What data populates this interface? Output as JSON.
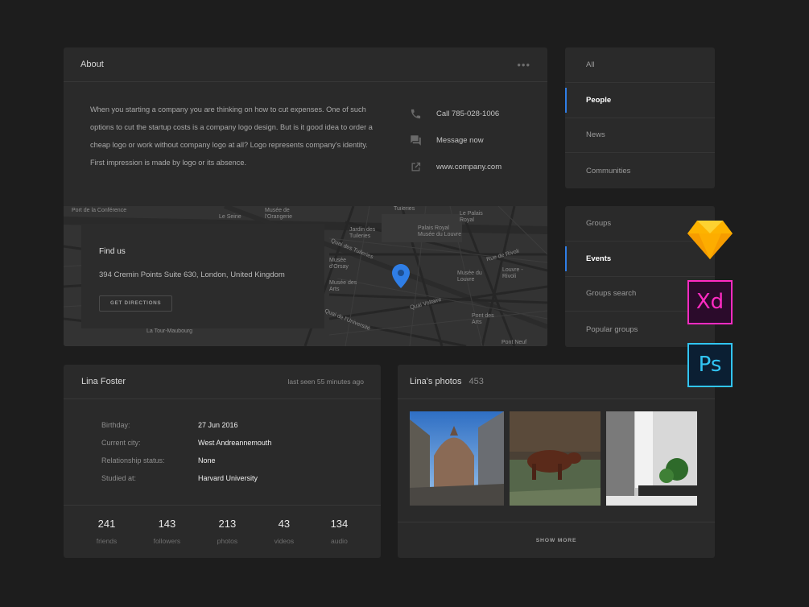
{
  "about": {
    "title": "About",
    "menu": "•••",
    "text": "When you starting a company you are thinking on how to cut expenses. One of such options to cut the startup costs is a company logo design. But is it good idea to order a cheap logo or work without company logo at all? Logo represents company's identity. First impression is made by logo or its absence.",
    "contacts": [
      {
        "icon": "phone-icon",
        "label": "Call  785-028-1006"
      },
      {
        "icon": "message-icon",
        "label": "Message now"
      },
      {
        "icon": "external-link-icon",
        "label": "www.company.com"
      }
    ]
  },
  "map": {
    "find_title": "Find us",
    "address": "394 Cremin Points Suite 630, London, United Kingdom",
    "directions_label": "GET DIRECTIONS",
    "labels": [
      "Port de la Conférence",
      "Musée de l'Orangerie",
      "Le Seine",
      "Jardin des Tuileries",
      "Le Palais Royal",
      "Palais Royal Musée du Louvre",
      "Tuileries",
      "Quai des Tuileries",
      "Rue de Rivoli",
      "Musée d'Orsay",
      "Musée du Louvre",
      "Louvre - Rivoli",
      "Quai Voltaire",
      "Pont des Arts",
      "Quai de l'Université",
      "La Tour-Maubourg",
      "Pont Neuf",
      "Musée des Arts"
    ],
    "pin_color": "#2f7ee6"
  },
  "nav1": {
    "items": [
      {
        "label": "All",
        "active": false
      },
      {
        "label": "People",
        "active": true
      },
      {
        "label": "News",
        "active": false
      },
      {
        "label": "Communities",
        "active": false
      }
    ]
  },
  "nav2": {
    "items": [
      {
        "label": "Groups",
        "active": false
      },
      {
        "label": "Events",
        "active": true
      },
      {
        "label": "Groups search",
        "active": false
      },
      {
        "label": "Popular groups",
        "active": false
      }
    ]
  },
  "profile": {
    "name": "Lina Foster",
    "last_seen": "last seen 55 minutes ago",
    "info": [
      {
        "key": "Birthday:",
        "value": "27 Jun 2016"
      },
      {
        "key": "Current city:",
        "value": "West Andreannemouth"
      },
      {
        "key": "Relationship status:",
        "value": "None"
      },
      {
        "key": "Studied at:",
        "value": "Harvard University"
      }
    ],
    "stats": [
      {
        "n": "241",
        "label": "friends"
      },
      {
        "n": "143",
        "label": "followers"
      },
      {
        "n": "213",
        "label": "photos"
      },
      {
        "n": "43",
        "label": "videos"
      },
      {
        "n": "134",
        "label": "audio"
      }
    ]
  },
  "photos": {
    "title": "Lina's photos",
    "count": "453",
    "show_more": "SHOW MORE"
  },
  "apps": {
    "sketch": "sketch-icon",
    "xd": "Xd",
    "ps": "Ps"
  },
  "colors": {
    "accent": "#2f7ee6",
    "background": "#1d1d1d",
    "card": "#2a2a2a"
  }
}
